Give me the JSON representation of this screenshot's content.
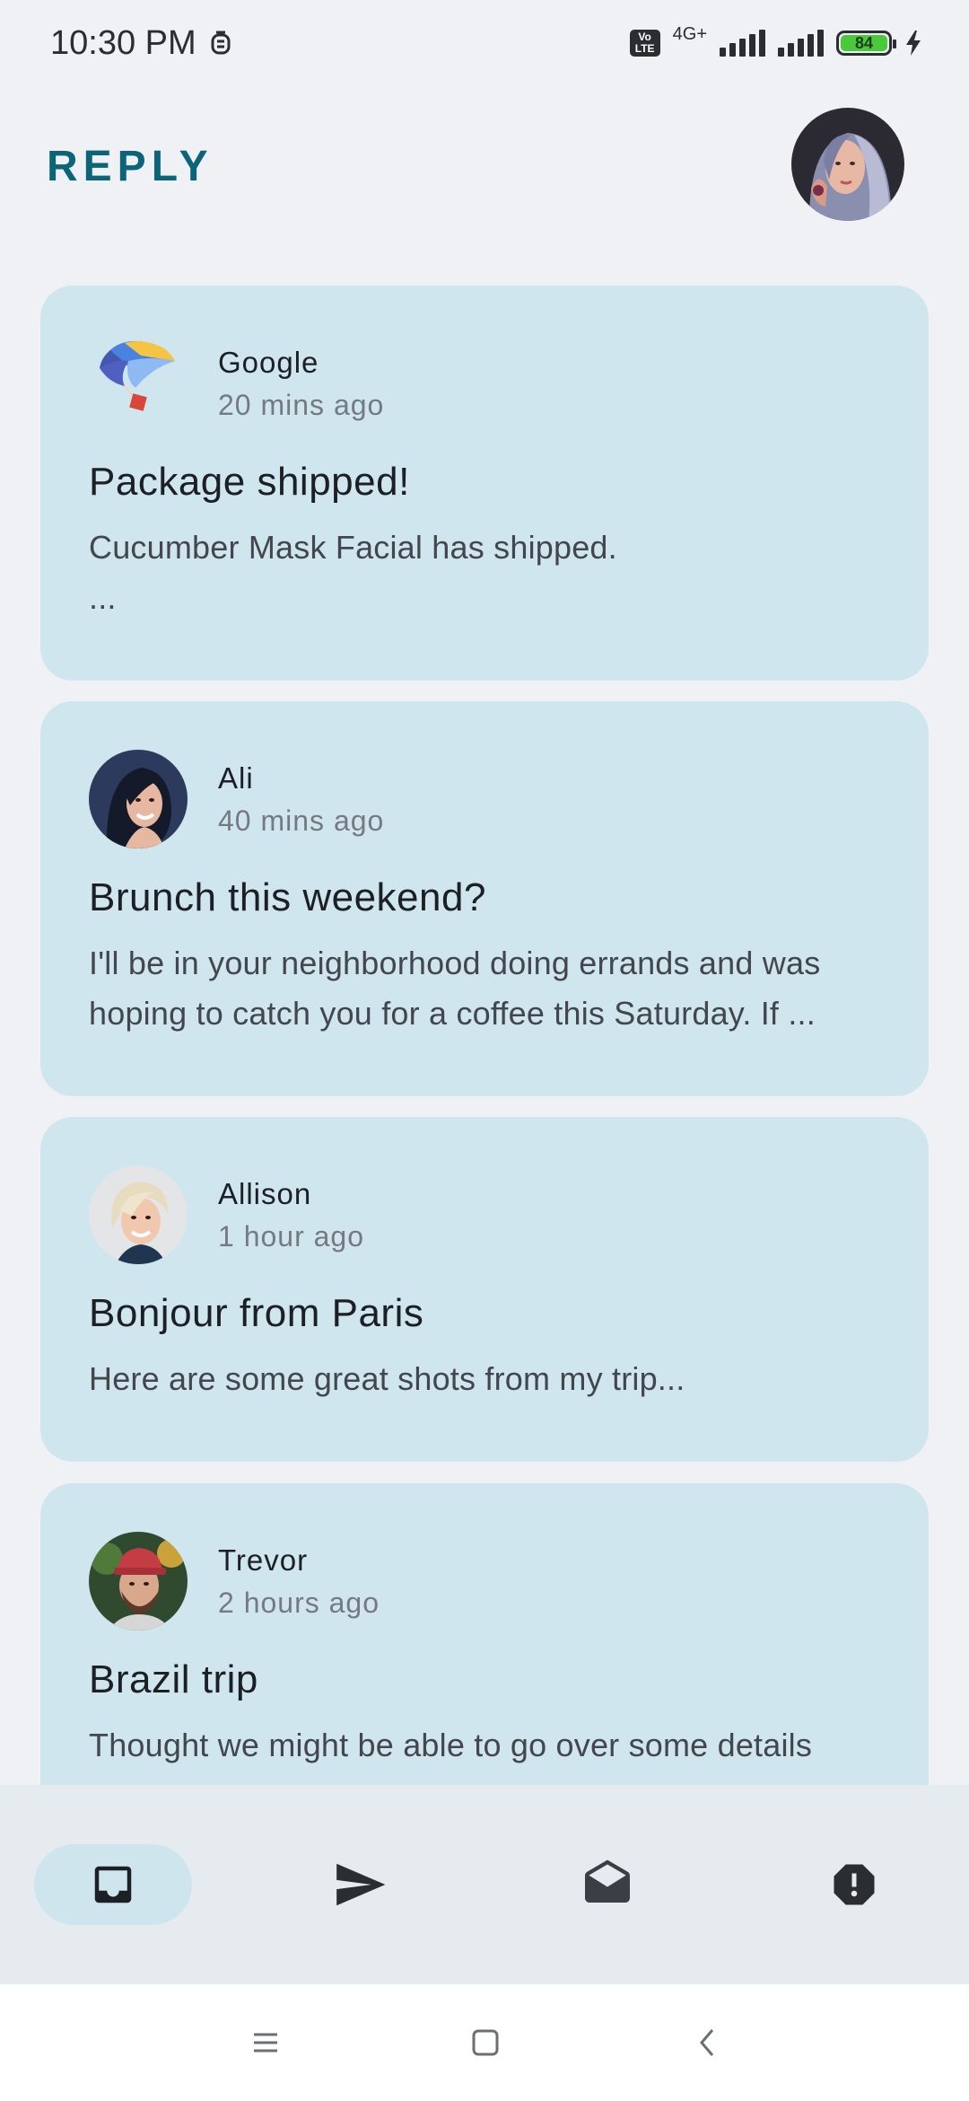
{
  "status_bar": {
    "time": "10:30 PM",
    "volte": "Vo LTE",
    "network": "4G+",
    "battery": "84",
    "icons": [
      "alarm-icon",
      "volte-icon",
      "signal-icon",
      "signal-icon",
      "battery-icon",
      "charging-icon"
    ]
  },
  "app": {
    "title": "REPLY"
  },
  "emails": [
    {
      "sender": "Google",
      "time": "20 mins ago",
      "subject": "Package shipped!",
      "preview": "Cucumber Mask Facial has shipped.\n..."
    },
    {
      "sender": "Ali",
      "time": "40 mins ago",
      "subject": "Brunch this weekend?",
      "preview": "I'll be in your neighborhood doing errands and was hoping to catch you for a coffee this Saturday. If ..."
    },
    {
      "sender": "Allison",
      "time": "1 hour ago",
      "subject": "Bonjour from Paris",
      "preview": "Here are some great shots from my trip..."
    },
    {
      "sender": "Trevor",
      "time": "2 hours ago",
      "subject": "Brazil trip",
      "preview": "Thought we might be able to go over some details"
    }
  ],
  "bottom_nav": {
    "items": [
      "inbox-icon",
      "send-icon",
      "drafts-icon",
      "report-icon"
    ],
    "active": "inbox-icon"
  },
  "colors": {
    "accent": "#0b6478",
    "card": "#d0e6ee",
    "background": "#f0f1f4"
  }
}
